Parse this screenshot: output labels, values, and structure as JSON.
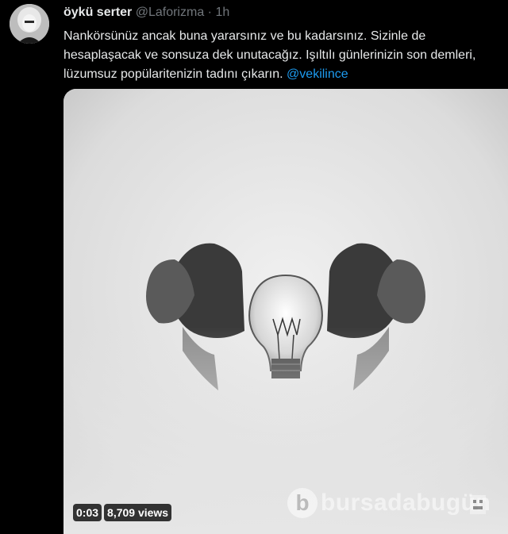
{
  "tweet": {
    "author": {
      "display_name": "öykü serter",
      "handle": "@Laforizma",
      "separator": "·",
      "time": "1h"
    },
    "text": "Nankörsünüz ancak buna yararsınız ve bu kadarsınız. Sizinle de hesaplaşacak ve sonsuza dek unutacağız. Işıltılı günlerinizin son demleri, lüzumsuz popülaritenizin tadını çıkarın.",
    "mention": "@vekilince",
    "media": {
      "type": "video",
      "duration": "0:03",
      "views": "8,709 views",
      "watermark": "bursadabugün",
      "watermark_logo": "b"
    }
  },
  "icons": [
    "avatar",
    "video-watermark-logo"
  ],
  "colors": {
    "background": "#000000",
    "text": "#e7e9ea",
    "secondary_text": "#71767b",
    "link": "#1d9bf0"
  }
}
